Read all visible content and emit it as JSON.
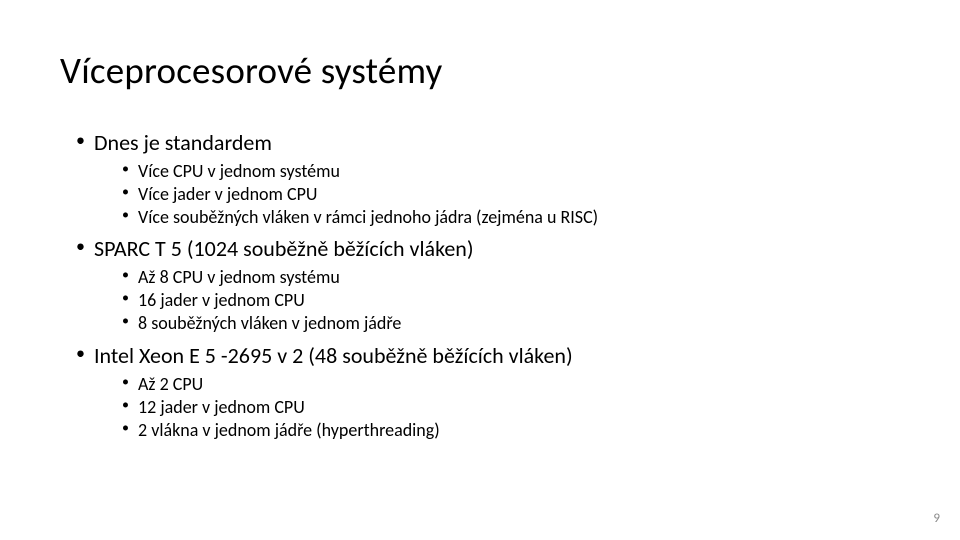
{
  "title": "Víceprocesorové systémy",
  "bullets": [
    {
      "text": "Dnes je standardem",
      "sub": [
        "Více CPU v jednom systému",
        "Více jader v jednom CPU",
        "Více souběžných vláken v rámci jednoho jádra (zejména u RISC)"
      ]
    },
    {
      "text": "SPARC T 5 (1024 souběžně běžících vláken)",
      "sub": [
        "Až 8 CPU v jednom systému",
        "16 jader v jednom CPU",
        "8 souběžných vláken v jednom jádře"
      ]
    },
    {
      "text": "Intel Xeon E 5 -2695 v 2 (48 souběžně běžících vláken)",
      "sub": [
        "Až 2 CPU",
        "12 jader v jednom CPU",
        "2 vlákna v jednom jádře (hyperthreading)"
      ]
    }
  ],
  "page_number": "9"
}
